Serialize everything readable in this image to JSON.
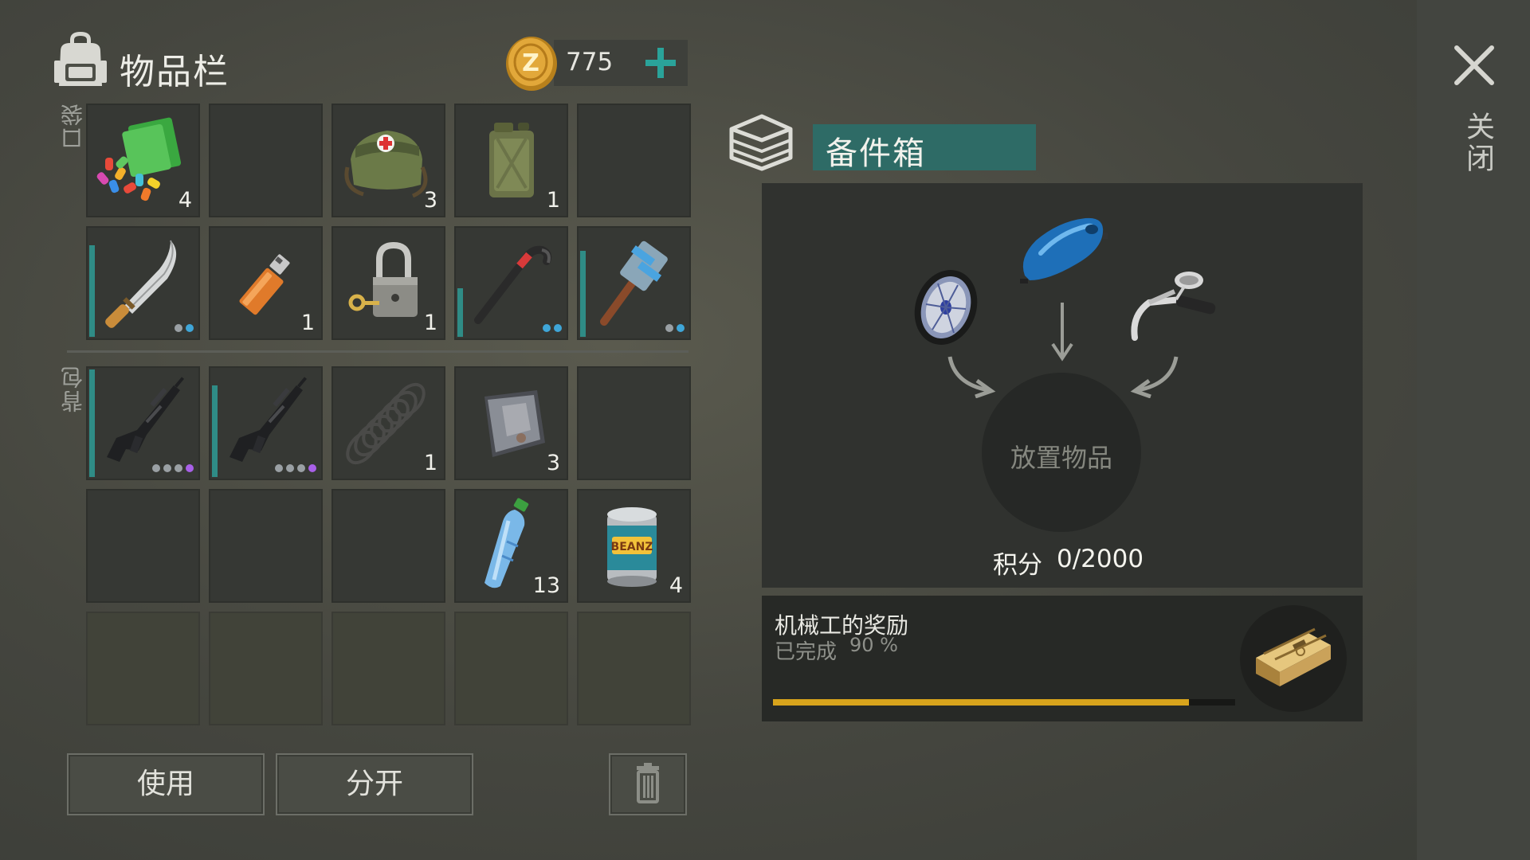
{
  "header": {
    "title": "物品栏",
    "coins": "775"
  },
  "labels": {
    "pockets": "口袋",
    "backpack": "背包"
  },
  "inventory": {
    "pockets": [
      {
        "item": "paint-and-pills-icon",
        "count": "4"
      },
      {
        "item": "empty",
        "count": ""
      },
      {
        "item": "first-aid-bag-icon",
        "count": "3"
      },
      {
        "item": "jerry-can-icon",
        "count": "1"
      },
      {
        "item": "empty",
        "count": ""
      },
      {
        "item": "machete-icon",
        "count": "",
        "durability": 0.85,
        "dots": [
          "g",
          "b"
        ]
      },
      {
        "item": "lighter-icon",
        "count": "1"
      },
      {
        "item": "padlock-icon",
        "count": "1"
      },
      {
        "item": "crowbar-icon",
        "count": "",
        "durability": 0.45,
        "dots": [
          "b",
          "b"
        ]
      },
      {
        "item": "sledgehammer-icon",
        "count": "",
        "durability": 0.8,
        "dots": [
          "g",
          "b"
        ]
      }
    ],
    "backpack": [
      {
        "item": "assault-rifle-icon",
        "count": "",
        "durability": 1.0,
        "dots": [
          "g",
          "g",
          "g",
          "p"
        ]
      },
      {
        "item": "assault-rifle-icon",
        "count": "",
        "durability": 0.85,
        "dots": [
          "g",
          "g",
          "g",
          "p"
        ]
      },
      {
        "item": "spring-icon",
        "count": "1"
      },
      {
        "item": "metal-plate-icon",
        "count": "3"
      },
      {
        "item": "empty",
        "count": ""
      },
      {
        "item": "empty",
        "count": ""
      },
      {
        "item": "empty",
        "count": ""
      },
      {
        "item": "empty",
        "count": ""
      },
      {
        "item": "water-bottle-icon",
        "count": "13"
      },
      {
        "item": "canned-beans-icon",
        "count": "4"
      }
    ],
    "locked_slots": 5
  },
  "actions": {
    "use": "使用",
    "split": "分开",
    "trash": "trash-icon"
  },
  "close": {
    "label": "关闭"
  },
  "parts_box": {
    "title": "备件箱",
    "drop_hint": "放置物品",
    "score_label": "积分",
    "score_value": "0/2000",
    "parts": [
      "wheel-icon",
      "fuel-tank-icon",
      "handlebar-icon"
    ]
  },
  "reward": {
    "title": "机械工的奖励",
    "status": "已完成",
    "percent_text": "90 %",
    "progress": 0.9,
    "icon": "weapon-crate-icon"
  },
  "colors": {
    "accent_teal": "#2e6b66",
    "plus_teal": "#2aa39a",
    "progress_gold": "#d8a41c",
    "durability_teal": "#2f8c86"
  }
}
